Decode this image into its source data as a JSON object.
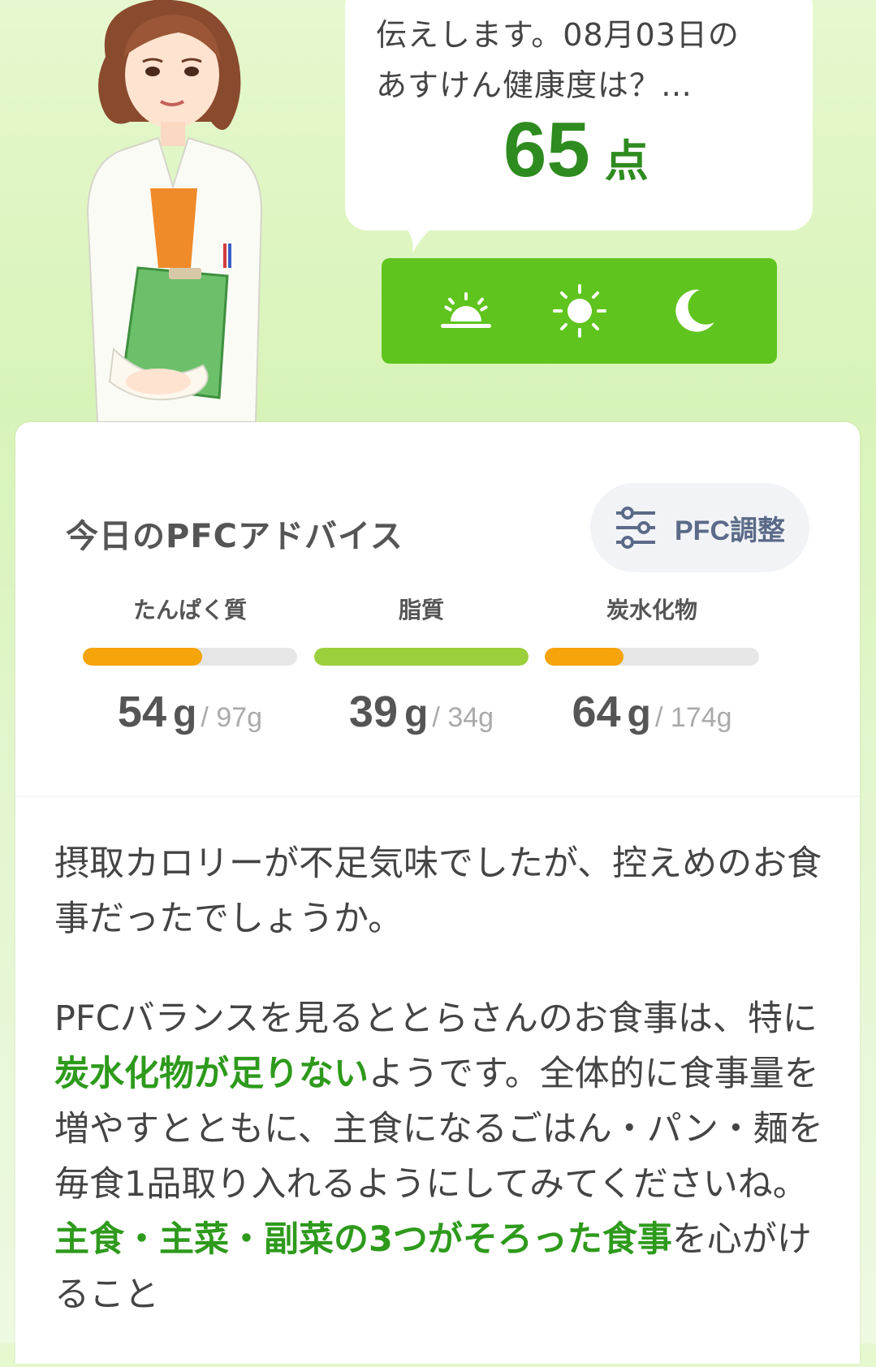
{
  "bubble": {
    "line1": "伝えします。08月03日の",
    "line2": "あすけん健康度は？…",
    "score": "65",
    "score_unit": "点"
  },
  "time_buttons": [
    {
      "icon": "sunrise-icon"
    },
    {
      "icon": "sun-icon"
    },
    {
      "icon": "moon-icon"
    }
  ],
  "card": {
    "title": "今日のPFCアドバイス",
    "adjust_label": "PFC調整"
  },
  "nutrients": [
    {
      "name": "たんぱく質",
      "current": "54",
      "unit": "g",
      "target": "97",
      "fill": 0.557,
      "color": "#f5a40a"
    },
    {
      "name": "脂質",
      "current": "39",
      "unit": "g",
      "target": "34",
      "fill": 1.0,
      "color": "#9ccf3c"
    },
    {
      "name": "炭水化物",
      "current": "64",
      "unit": "g",
      "target": "174",
      "fill": 0.368,
      "color": "#f5a40a"
    }
  ],
  "advice": {
    "p1": "摂取カロリーが不足気味でしたが、控えめのお食事だったでしょうか。",
    "p2_a": "PFCバランスを見るととらさんのお食事は、特に",
    "p2_hl1": "炭水化物が足りない",
    "p2_b": "ようです。全体的に食事量を増やすとともに、主食になるごはん・パン・麺を毎食1品取り入れるようにしてみてくださいね。",
    "p2_hl2": "主食・主菜・副菜の3つがそろった食事",
    "p2_c": "を心がけること"
  },
  "colors": {
    "accent_green": "#5fc41e",
    "score_green": "#2e8b1f",
    "protein_bar": "#f5a40a",
    "fat_bar": "#9ccf3c",
    "carb_bar": "#f5a40a"
  }
}
